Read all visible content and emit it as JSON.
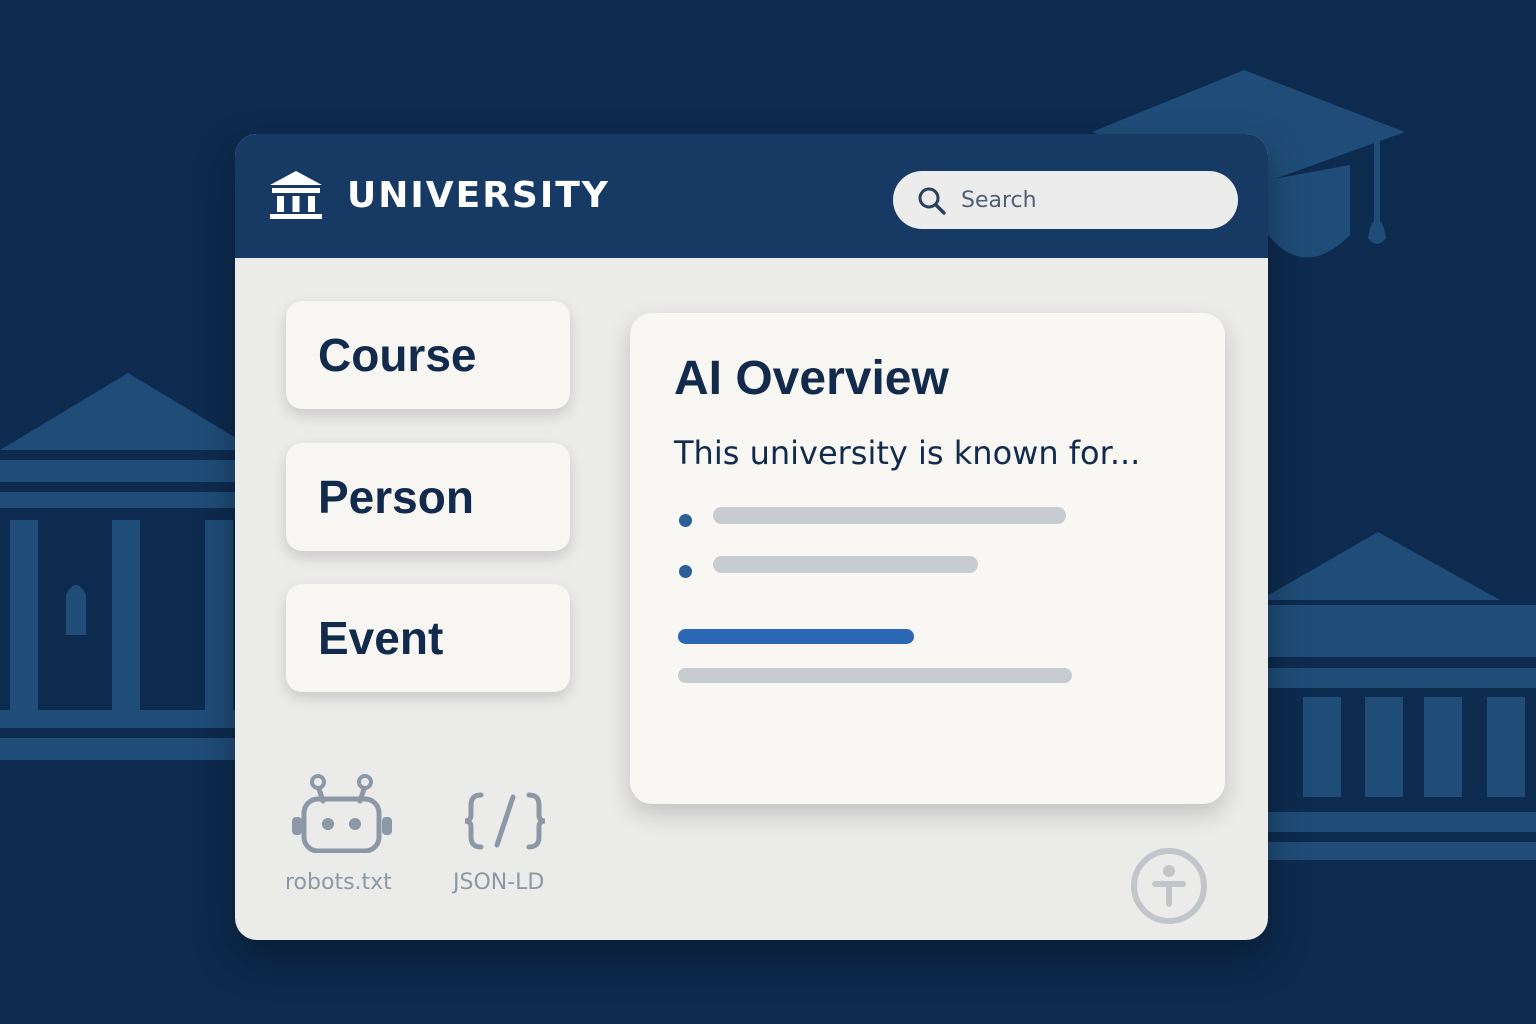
{
  "colors": {
    "background": "#0d2b4f",
    "header": "#163a63",
    "panel": "#ebebea",
    "card": "#f7f6f3",
    "text_dark": "#122a4b",
    "accent": "#2c67b5",
    "placeholder_bar": "#c7ccd1"
  },
  "header": {
    "brand": "UNIVERSITY",
    "logo_icon": "university-building-icon"
  },
  "search": {
    "placeholder": "Search",
    "icon": "search-icon"
  },
  "nav": {
    "items": [
      {
        "label": "Course"
      },
      {
        "label": "Person"
      },
      {
        "label": "Event"
      }
    ]
  },
  "overview": {
    "title": "AI Overview",
    "text": "This university is known for..."
  },
  "tools": [
    {
      "label": "robots.txt",
      "icon": "robot-icon"
    },
    {
      "label": "JSON-LD",
      "icon": "code-braces-icon"
    }
  ],
  "footer": {
    "icon": "accessibility-icon"
  }
}
